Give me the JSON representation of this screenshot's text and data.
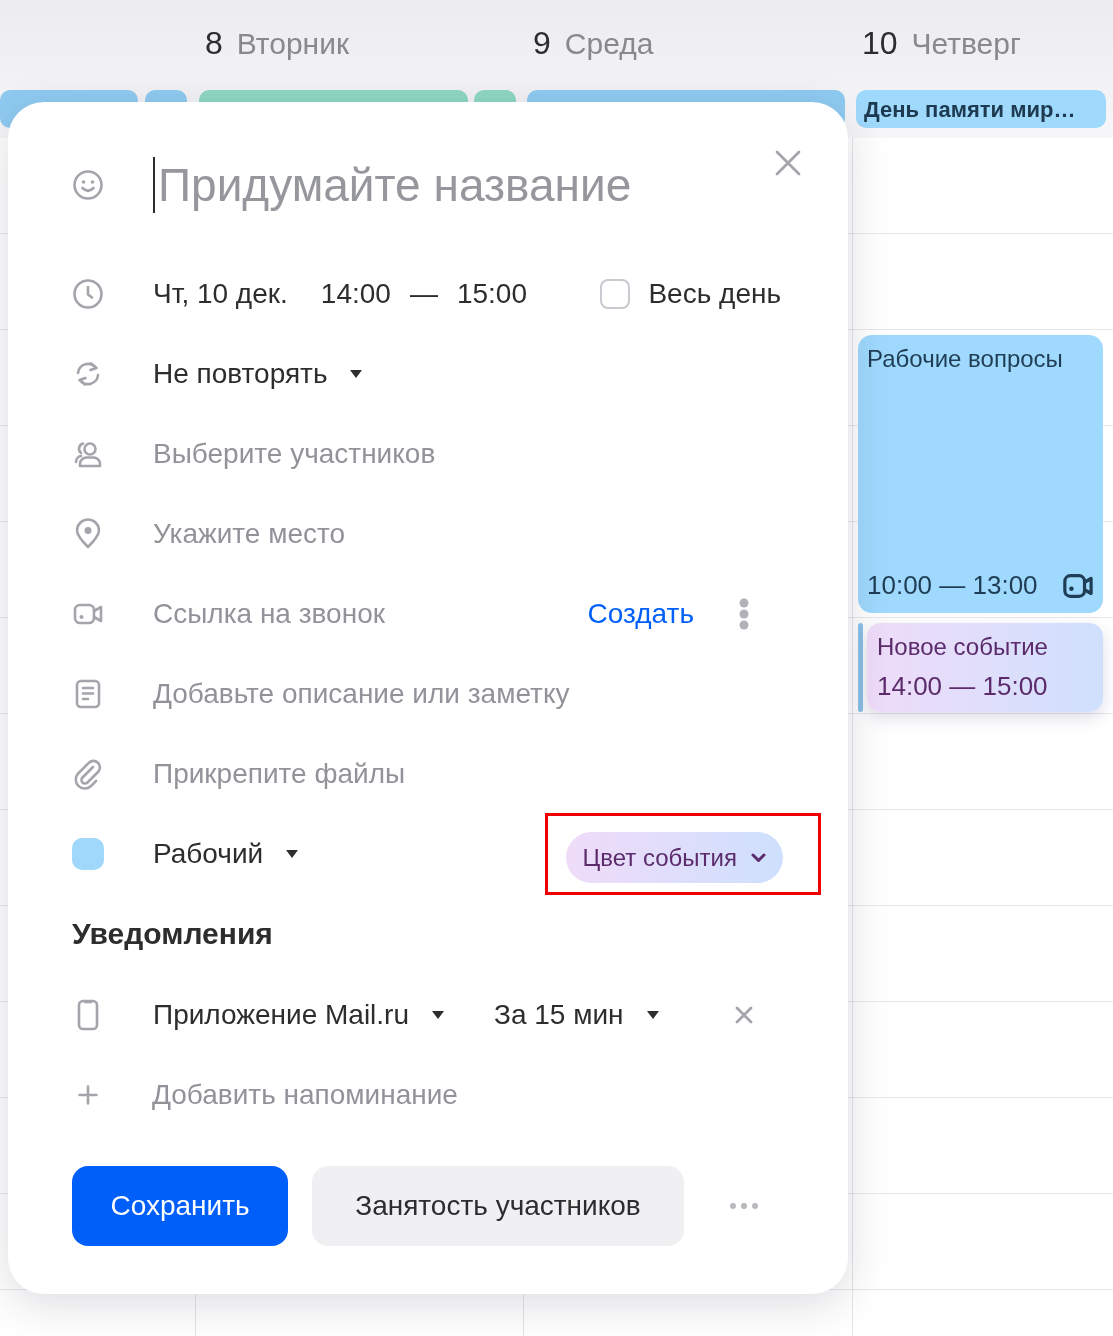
{
  "calendar": {
    "columns": [
      {
        "all_day": [
          {
            "kind": "event",
            "color": "#8fcbf1"
          },
          {
            "kind": "more",
            "color": "#8fcbf1"
          }
        ]
      },
      {
        "number": "8",
        "weekday": "Вторник",
        "all_day": [
          {
            "kind": "event",
            "color": "#8ed8c3"
          },
          {
            "kind": "more",
            "color": "#8ed8c3"
          }
        ]
      },
      {
        "number": "9",
        "weekday": "Среда",
        "all_day": [
          {
            "kind": "event",
            "color": "#8fcbf1"
          }
        ]
      },
      {
        "number": "10",
        "weekday": "Четверг",
        "all_day": [
          {
            "kind": "event",
            "color": "#9fd9fc",
            "label": "День памяти мир…"
          }
        ],
        "events": [
          {
            "kind": "event",
            "title": "Рабочие вопросы",
            "time": "10:00 — 13:00",
            "color": "#9fd9fd",
            "video": true
          },
          {
            "kind": "draft",
            "title": "Новое событие",
            "time": "14:00 — 15:00"
          }
        ]
      }
    ]
  },
  "dialog": {
    "title_placeholder": "Придумайте название",
    "datetime": {
      "date": "Чт, 10 дек.",
      "start": "14:00",
      "separator": "—",
      "end": "15:00",
      "all_day": {
        "label": "Весь день",
        "checked": false
      }
    },
    "repeat": {
      "value": "Не повторять"
    },
    "participants": {
      "placeholder": "Выберите участников"
    },
    "location": {
      "placeholder": "Укажите место"
    },
    "call_link": {
      "label": "Ссылка на звонок",
      "action": "Создать"
    },
    "description": {
      "placeholder": "Добавьте описание или заметку"
    },
    "attachments": {
      "label": "Прикрепите файлы"
    },
    "calendar": {
      "color": "#a0d8fc",
      "value": "Рабочий"
    },
    "event_color": {
      "label": "Цвет события",
      "highlighted": true
    },
    "notifications": {
      "title": "Уведомления",
      "items": [
        {
          "channel": "Приложение Mail.ru",
          "time": "За 15 мин"
        }
      ],
      "add_label": "Добавить напоминание"
    },
    "buttons": {
      "save": "Сохранить",
      "availability": "Занятость участников"
    }
  }
}
